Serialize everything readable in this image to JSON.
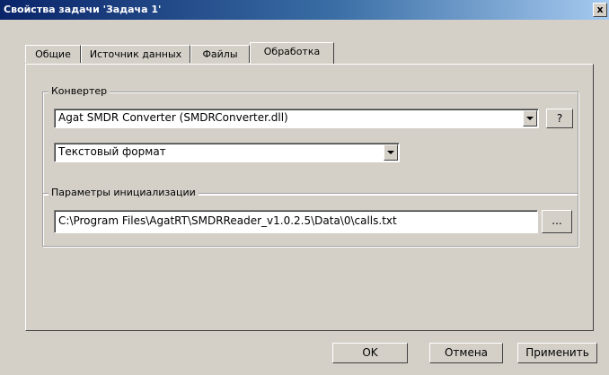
{
  "window": {
    "title": "Свойства задачи 'Задача 1'",
    "close_label": "x"
  },
  "tabs": [
    {
      "label": "Общие"
    },
    {
      "label": "Источник данных"
    },
    {
      "label": "Файлы"
    },
    {
      "label": "Обработка",
      "active": true
    }
  ],
  "converter_group": {
    "label": "Конвертер",
    "converter_value": "Agat SMDR Converter (SMDRConverter.dll)",
    "help_label": "?",
    "format_value": "Текстовый формат"
  },
  "init_group": {
    "label": "Параметры инициализации",
    "path_value": "C:\\Program Files\\AgatRT\\SMDRReader_v1.0.2.5\\Data\\0\\calls.txt",
    "browse_label": "..."
  },
  "buttons": {
    "ok": "OK",
    "cancel": "Отмена",
    "apply": "Применить"
  },
  "colors": {
    "title_start": "#0a246a",
    "title_end": "#a6caf0",
    "face": "#d4d0c8",
    "highlight": "#e00000"
  }
}
